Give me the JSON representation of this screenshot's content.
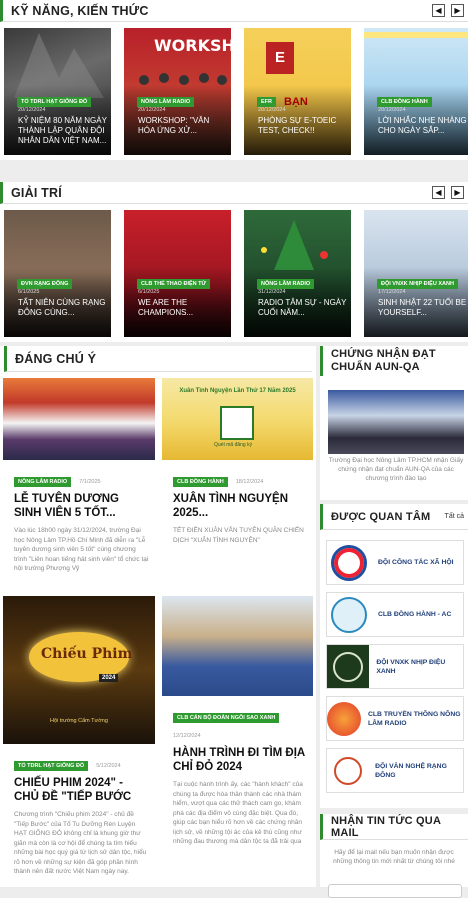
{
  "skills": {
    "title": "KỸ NĂNG, KIẾN THỨC",
    "cards": [
      {
        "tag": "TỔ TDRL HẠT GIỐNG ĐỎ",
        "date": "20/12/2024",
        "title": "KỶ NIỆM 80 NĂM NGÀY THÀNH LẬP QUÂN ĐỘI NHÂN DÂN VIỆT NAM..."
      },
      {
        "tag": "NÔNG LÂM RADIO",
        "date": "20/12/2024",
        "title": "WORKSHOP: \"VĂN HÓA ỨNG XỬ..."
      },
      {
        "tag": "EFR",
        "date": "20/12/2024",
        "title": "PHÒNG SỰ E-TOEIC TEST, CHECK!!"
      },
      {
        "tag": "CLB ĐỒNG HÀNH",
        "date": "20/12/2024",
        "title": "LỜI NHẮC NHẸ NHÀNG CHO NGÀY SẮP..."
      }
    ]
  },
  "entertainment": {
    "title": "GIẢI TRÍ",
    "cards": [
      {
        "tag": "ĐVN RẠNG ĐÔNG",
        "date": "6/1/2025",
        "title": "TẤT NIÊN CÙNG RẠNG ĐÔNG CÙNG..."
      },
      {
        "tag": "CLB THỂ THAO ĐIỆN TỬ",
        "date": "6/1/2025",
        "title": "WE ARE THE CHAMPIONS..."
      },
      {
        "tag": "NÔNG LÂM RADIO",
        "date": "31/12/2024",
        "title": "RADIO TÂM SỰ - NGÀY CUỐI NĂM..."
      },
      {
        "tag": "ĐỘI VNXK NHỊP ĐIỆU XANH",
        "date": "17/12/2024",
        "title": "SINH NHẬT 22 TUỔI BE YOURSELF..."
      }
    ]
  },
  "featured": {
    "title": "ĐÁNG CHÚ Ý",
    "posts": [
      {
        "tag": "NÔNG LÂM RADIO",
        "date": "7/1/2025",
        "title": "LỄ TUYÊN DƯƠNG SINH VIÊN 5 TỐT...",
        "excerpt": "Vào lúc 18h00 ngày 31/12/2024, trường Đại học Nông Lâm TP.Hồ Chí Minh đã diễn ra \"Lễ tuyên dương sinh viên 5 tốt\" cùng chương trình \"Liên hoan tiếng hát sinh viên\" tổ chức tại hội trường Phượng Vỹ"
      },
      {
        "tag": "CLB ĐỒNG HÀNH",
        "date": "18/12/2024",
        "title": "XUÂN TÌNH NGUYỆN 2025...",
        "excerpt": "TẾT ĐIỀN XUÂN VẪN TUYÊN QUÂN CHIẾN DỊCH \"XUÂN TÌNH NGUYỆN\"",
        "banner_top": "Xuân Tình Nguyện Lần Thứ 17 Năm 2025",
        "banner_qr": "Quét mã đăng ký"
      },
      {
        "tag": "TỔ TDRL HẠT GIỐNG ĐỎ",
        "date": "5/12/2024",
        "title": "CHIẾU PHIM 2024\" - CHỦ ĐỀ \"TIẾP BƯỚC",
        "excerpt": "Chương trình \"Chiếu phim 2024\" - chủ đề \"Tiếp Bước\" của Tổ Tu Dưỡng Rèn Luyện HẠT GIỐNG ĐỎ không chỉ là khung giờ thư giãn mà còn là cơ hội để chúng ta tìm hiểu những bài học quý giá từ lịch sử dân tộc, hiểu rõ hơn về những sự kiện đã góp phần hình thành nên đất nước Việt Nam ngày nay.",
        "poster_title": "Chiếu Phim",
        "poster_year": "2024",
        "poster_place": "Hội trường Cẩm Tường"
      },
      {
        "tag": "CLB CÁN BỘ ĐOÀN NGÔI SAO XANH",
        "date": "12/12/2024",
        "title": "HÀNH TRÌNH ĐI TÌM ĐỊA CHỈ ĐỎ 2024",
        "excerpt": "Tại cuộc hành trình ấy, các \"hành khách\" của chúng ta được hòa thân thành các nhà thám hiểm, vượt qua các thử thách cam go, khám phá các địa điểm vô cùng đặc biệt. Qua đó, giúp các bạn hiểu rõ hơn về các chứng nhân lịch sử, về những tội ác của kẻ thù cũng như những đau thương mà dân tộc ta đã trải qua"
      }
    ]
  },
  "aun": {
    "title": "CHỨNG NHẬN ĐẠT CHUẨN AUN-QA",
    "caption": "Trường Đại học Nông Lâm TP.HCM nhận Giấy chứng nhận đạt chuẩn AUN-QA của các chương trình đào tạo"
  },
  "popular": {
    "title": "ĐƯỢC QUAN TÂM",
    "see_all": "Tất cả",
    "items": [
      {
        "name": "ĐỘI CÔNG TÁC XÃ HỘI",
        "icon": "ctxh-logo"
      },
      {
        "name": "CLB ĐỒNG HÀNH - AC",
        "icon": "dong-hanh-logo"
      },
      {
        "name": "ĐỘI VNXK NHỊP ĐIỆU XANH",
        "icon": "nhip-dieu-xanh-logo"
      },
      {
        "name": "CLB TRUYỀN THÔNG NÔNG LÂM RADIO",
        "icon": "nong-lam-radio-logo"
      },
      {
        "name": "ĐỘI VĂN NGHỆ RẠNG ĐÔNG",
        "icon": "rang-dong-logo"
      }
    ]
  },
  "newsletter": {
    "title": "NHẬN TIN TỨC QUA MAIL",
    "desc": "Hãy để lại mail nếu bạn muốn nhận được những thông tin mới nhất từ chúng tôi nhé"
  },
  "colors": {
    "accent": "#2e8b2e",
    "tag_bg": "#2f9a2f",
    "fav_text": "#1f3f7a"
  }
}
